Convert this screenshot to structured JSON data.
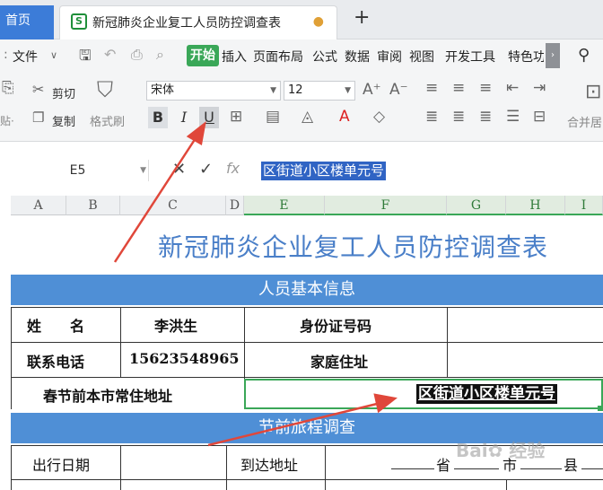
{
  "tabs": {
    "home_label": "首页",
    "doc_title": "新冠肺炎企业复工人员防控调查表",
    "unsaved_dot": "●",
    "new_tab": "+"
  },
  "menu": {
    "file": "文件",
    "start": "开始",
    "items": [
      "插入",
      "页面布局",
      "公式",
      "数据",
      "审阅",
      "视图",
      "开发工具",
      "特色功"
    ],
    "more": "›"
  },
  "ribbon": {
    "cut": "剪切",
    "copy": "复制",
    "format_painter": "格式刷",
    "paste_tail": "贴·",
    "font_name": "宋体",
    "font_size": "12",
    "bold": "B",
    "italic": "I",
    "underline": "U",
    "merge": "合并居"
  },
  "formula_bar": {
    "cell_ref": "E5",
    "content": "区街道小区楼单元号"
  },
  "columns": [
    "A",
    "B",
    "C",
    "D",
    "E",
    "F",
    "G",
    "H",
    "I"
  ],
  "sheet": {
    "title": "新冠肺炎企业复工人员防控调查表",
    "section1": "人员基本信息",
    "name_label": "姓　　名",
    "name_value": "李洪生",
    "id_label": "身份证号码",
    "phone_label": "联系电话",
    "phone_value": "15623548965",
    "home_addr_label": "家庭住址",
    "resident_label": "春节前本市常住地址",
    "resident_value": "区街道小区楼单元号",
    "section2": "节前旅程调查",
    "travel_date_label": "出行日期",
    "dest_label": "到达地址",
    "province": "省",
    "city": "市",
    "county": "县"
  },
  "colors": {
    "accent_green": "#3aa758",
    "band_blue": "#4f8fd6",
    "title_blue": "#4a7fc8",
    "arrow_red": "#e0473a"
  }
}
